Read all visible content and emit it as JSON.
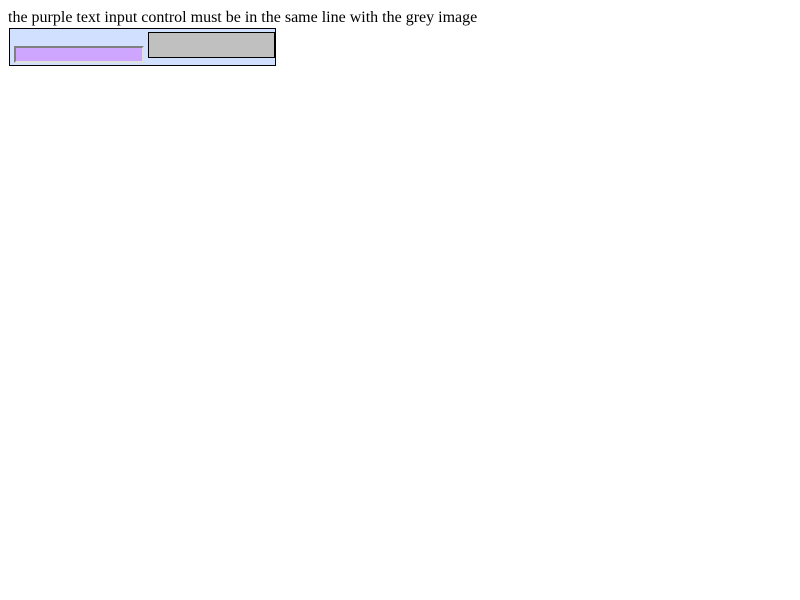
{
  "page": {
    "instruction": "the purple text input control must be in the same line with the grey image"
  },
  "test_box": {
    "background_color": "#d2e0ff",
    "text_input": {
      "value": "",
      "placeholder": "",
      "background_color": "#cfa6ff"
    },
    "grey_image": {
      "background_color": "#c0c0c0"
    }
  }
}
